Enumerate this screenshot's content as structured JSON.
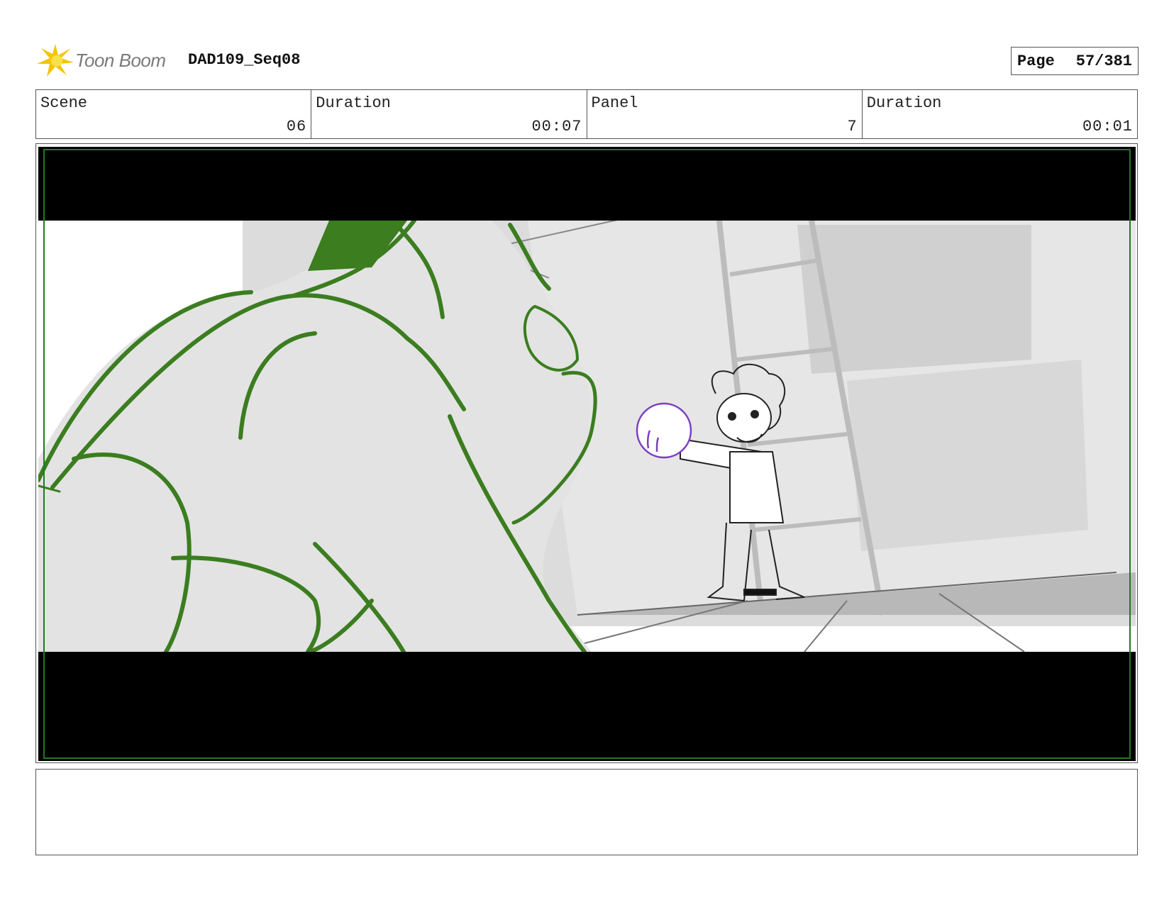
{
  "header": {
    "brand": "Toon Boom",
    "project": "DAD109_Seq08",
    "page_label": "Page",
    "page_value": "57/381"
  },
  "info": [
    {
      "label": "Scene",
      "value": "06"
    },
    {
      "label": "Duration",
      "value": "00:07"
    },
    {
      "label": "Panel",
      "value": "7"
    },
    {
      "label": "Duration",
      "value": "00:01"
    }
  ],
  "colors": {
    "sketch_green": "#3b7d1f",
    "sketch_purple": "#7a3fc4",
    "letterbox": "#000000",
    "safe_frame": "#1f7a1f"
  },
  "notes": {
    "text": ""
  }
}
